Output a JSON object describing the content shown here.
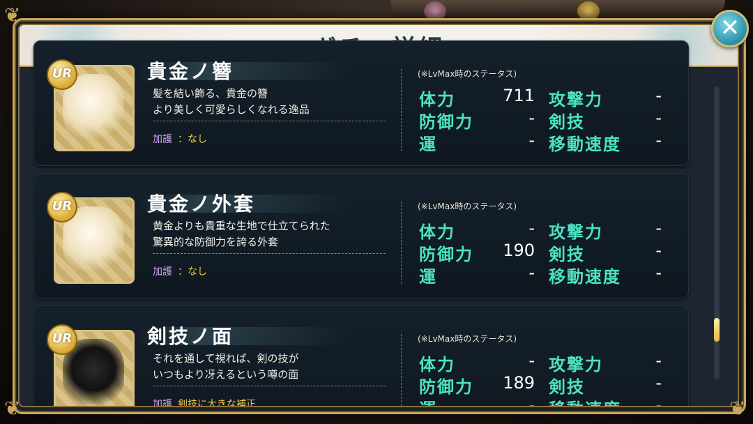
{
  "window": {
    "title": "ガチャ詳細",
    "close_label": "✕"
  },
  "items": [
    {
      "name": "貴金ノ簪",
      "badge": "UR",
      "description": "髪を結い飾る、貴金の簪\nより美しく可愛らしくなれる逸品",
      "blessing_label": "加護",
      "blessing_value": "：なし",
      "lv_note": "(※LvMax時のステータス)",
      "stats": [
        {
          "label": "体力",
          "value": "711"
        },
        {
          "label": "攻撃力",
          "value": "-"
        },
        {
          "label": "防御力",
          "value": "-"
        },
        {
          "label": "剣技",
          "value": "-"
        },
        {
          "label": "運",
          "value": "-"
        },
        {
          "label": "移動速度",
          "value": "-"
        }
      ]
    },
    {
      "name": "貴金ノ外套",
      "badge": "UR",
      "description": "黄金よりも貴重な生地で仕立てられた\n驚異的な防御力を誇る外套",
      "blessing_label": "加護",
      "blessing_value": "：なし",
      "lv_note": "(※LvMax時のステータス)",
      "stats": [
        {
          "label": "体力",
          "value": "-"
        },
        {
          "label": "攻撃力",
          "value": "-"
        },
        {
          "label": "防御力",
          "value": "190"
        },
        {
          "label": "剣技",
          "value": "-"
        },
        {
          "label": "運",
          "value": "-"
        },
        {
          "label": "移動速度",
          "value": "-"
        }
      ]
    },
    {
      "name": "剣技ノ面",
      "badge": "UR",
      "description": "それを通して視れば、剣の技が\nいつもより冴えるという噂の面",
      "blessing_label": "加護",
      "blessing_value": "剣技に大きな補正",
      "lv_note": "(※LvMax時のステータス)",
      "stats": [
        {
          "label": "体力",
          "value": "-"
        },
        {
          "label": "攻撃力",
          "value": "-"
        },
        {
          "label": "防御力",
          "value": "189"
        },
        {
          "label": "剣技",
          "value": "-"
        },
        {
          "label": "運",
          "value": "-"
        },
        {
          "label": "移動速度",
          "value": "-"
        }
      ]
    }
  ],
  "scroll": {
    "position_fraction": 0.86
  },
  "colors": {
    "stat_label": "#4be3c4",
    "title": "#1d3c46",
    "blessing_label": "#c9a2f2",
    "blessing_value": "#f0c84a"
  }
}
